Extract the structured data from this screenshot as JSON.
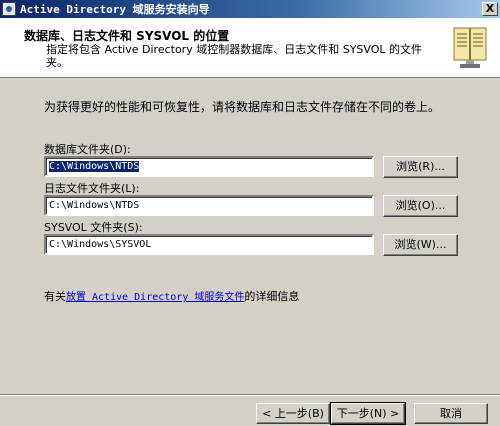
{
  "window": {
    "title": "Active Directory 域服务安装向导",
    "close_label": "X"
  },
  "header": {
    "title": "数据库、日志文件和 SYSVOL 的位置",
    "description": "指定将包含 Active Directory 域控制器数据库、日志文件和 SYSVOL 的文件夹。",
    "icon": "book-icon"
  },
  "intro": "为获得更好的性能和可恢复性，请将数据库和日志文件存储在不同的卷上。",
  "fields": [
    {
      "label": "数据库文件夹(D):",
      "value": "C:\\Windows\\NTDS",
      "browse_label": "浏览(R)..."
    },
    {
      "label": "日志文件文件夹(L):",
      "value": "C:\\Windows\\NTDS",
      "browse_label": "浏览(O)..."
    },
    {
      "label": "SYSVOL 文件夹(S):",
      "value": "C:\\Windows\\SYSVOL",
      "browse_label": "浏览(W)..."
    }
  ],
  "more_info": {
    "prefix": "有关",
    "link": "放置 Active Directory 域服务文件",
    "suffix": "的详细信息"
  },
  "buttons": {
    "back": "< 上一步(B)",
    "next": "下一步(N) >",
    "cancel": "取消"
  }
}
